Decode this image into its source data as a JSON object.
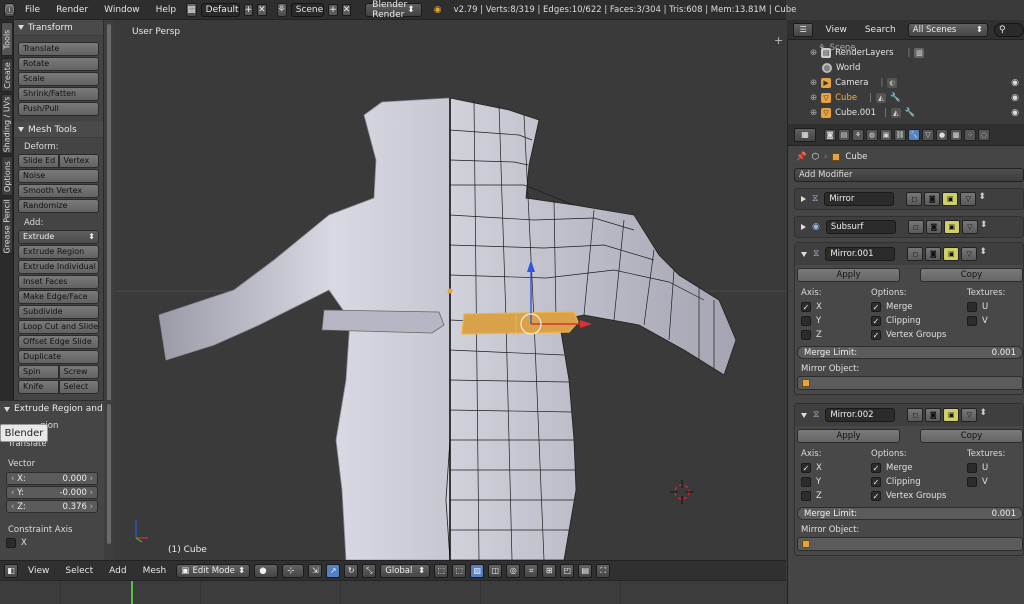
{
  "topbar": {
    "menus": [
      "File",
      "Render",
      "Window",
      "Help"
    ],
    "layout": "Default",
    "scene": "Scene",
    "renderer": "Blender Render",
    "stats": "v2.79 | Verts:8/319 | Edges:10/622 | Faces:3/304 | Tris:608 | Mem:13.81M | Cube"
  },
  "vtabs": [
    "Tools",
    "Create",
    "Shading / UVs",
    "Options",
    "Grease Pencil"
  ],
  "toolshelf": {
    "transform_title": "Transform",
    "transform": [
      "Translate",
      "Rotate",
      "Scale",
      "Shrink/Fatten",
      "Push/Pull"
    ],
    "mesh_title": "Mesh Tools",
    "deform_label": "Deform:",
    "deform_row": [
      "Slide Ed",
      "Vertex"
    ],
    "deform": [
      "Noise",
      "Smooth Vertex",
      "Randomize"
    ],
    "add_label": "Add:",
    "extrude": "Extrude",
    "add": [
      "Extrude Region",
      "Extrude Individual",
      "Inset Faces",
      "Make Edge/Face",
      "Subdivide",
      "Loop Cut and Slide",
      "Offset Edge Slide",
      "Duplicate"
    ],
    "bottom_row": [
      "Spin",
      "Screw"
    ],
    "cut_row": [
      "Knife",
      "Select"
    ]
  },
  "operator": {
    "title": "Extrude Region and",
    "sub": "gion",
    "translate": "Translate",
    "vector_label": "Vector",
    "vector": [
      {
        "label": "X:",
        "value": "0.000"
      },
      {
        "label": "Y:",
        "value": "-0.000"
      },
      {
        "label": "Z:",
        "value": "0.376"
      }
    ],
    "constraint_label": "Constraint Axis",
    "constraint_x": "X"
  },
  "tooltip": "Blender",
  "viewport": {
    "view_label": "User Persp",
    "object_label": "(1) Cube"
  },
  "vheader": {
    "menus": [
      "View",
      "Select",
      "Add",
      "Mesh"
    ],
    "mode": "Edit Mode",
    "orientation": "Global"
  },
  "outliner": {
    "menus": [
      "View",
      "Search"
    ],
    "filter": "All Scenes",
    "top_partial": "Scene",
    "rows": [
      "RenderLayers",
      "World",
      "Camera",
      "Cube",
      "Cube.001"
    ]
  },
  "props": {
    "path": "Cube",
    "add_modifier": "Add Modifier",
    "collapsed": [
      "Mirror",
      "Subsurf"
    ],
    "expanded": [
      {
        "name": "Mirror.001",
        "apply": "Apply",
        "copy": "Copy",
        "axis": "Axis:",
        "options": "Options:",
        "textures": "Textures:",
        "x": "X",
        "y": "Y",
        "z": "Z",
        "merge": "Merge",
        "clipping": "Clipping",
        "vgroups": "Vertex Groups",
        "u": "U",
        "v": "V",
        "limit_label": "Merge Limit:",
        "limit_value": "0.001",
        "mirror_obj": "Mirror Object:"
      },
      {
        "name": "Mirror.002",
        "apply": "Apply",
        "copy": "Copy",
        "axis": "Axis:",
        "options": "Options:",
        "textures": "Textures:",
        "x": "X",
        "y": "Y",
        "z": "Z",
        "merge": "Merge",
        "clipping": "Clipping",
        "vgroups": "Vertex Groups",
        "u": "U",
        "v": "V",
        "limit_label": "Merge Limit:",
        "limit_value": "0.001",
        "mirror_obj": "Mirror Object:"
      }
    ]
  },
  "colors": {
    "accent": "#5680c2",
    "selected_orange": "#e7a33d",
    "mesh": "#c8c8d2"
  }
}
